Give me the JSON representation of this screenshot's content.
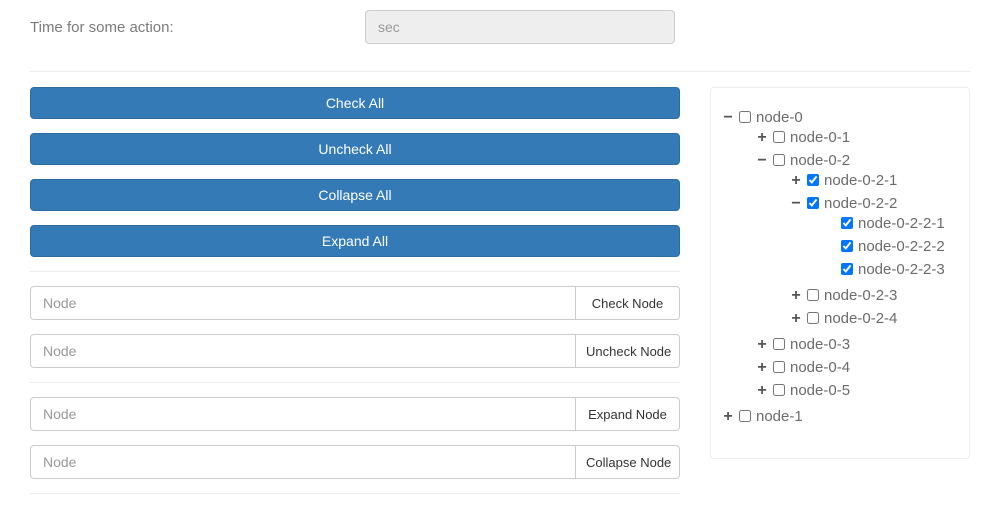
{
  "top": {
    "label": "Time for some action:",
    "sec_placeholder": "sec"
  },
  "buttons": {
    "check_all": "Check All",
    "uncheck_all": "Uncheck All",
    "collapse_all": "Collapse All",
    "expand_all": "Expand All"
  },
  "node_input_placeholder": "Node",
  "node_buttons": {
    "check": "Check Node",
    "uncheck": "Uncheck Node",
    "expand": "Expand Node",
    "collapse": "Collapse Node"
  },
  "tree": [
    {
      "label": "node-0",
      "expanded": true,
      "checked": false,
      "children": [
        {
          "label": "node-0-1",
          "expanded": false,
          "checked": false,
          "children": []
        },
        {
          "label": "node-0-2",
          "expanded": true,
          "checked": false,
          "children": [
            {
              "label": "node-0-2-1",
              "expanded": false,
              "checked": true,
              "children": []
            },
            {
              "label": "node-0-2-2",
              "expanded": true,
              "checked": true,
              "children": [
                {
                  "label": "node-0-2-2-1",
                  "expanded": null,
                  "checked": true,
                  "children": null
                },
                {
                  "label": "node-0-2-2-2",
                  "expanded": null,
                  "checked": true,
                  "children": null
                },
                {
                  "label": "node-0-2-2-3",
                  "expanded": null,
                  "checked": true,
                  "children": null
                }
              ]
            },
            {
              "label": "node-0-2-3",
              "expanded": false,
              "checked": false,
              "children": []
            },
            {
              "label": "node-0-2-4",
              "expanded": false,
              "checked": false,
              "children": []
            }
          ]
        },
        {
          "label": "node-0-3",
          "expanded": false,
          "checked": false,
          "children": []
        },
        {
          "label": "node-0-4",
          "expanded": false,
          "checked": false,
          "children": []
        },
        {
          "label": "node-0-5",
          "expanded": false,
          "checked": false,
          "children": []
        }
      ]
    },
    {
      "label": "node-1",
      "expanded": false,
      "checked": false,
      "children": []
    }
  ]
}
